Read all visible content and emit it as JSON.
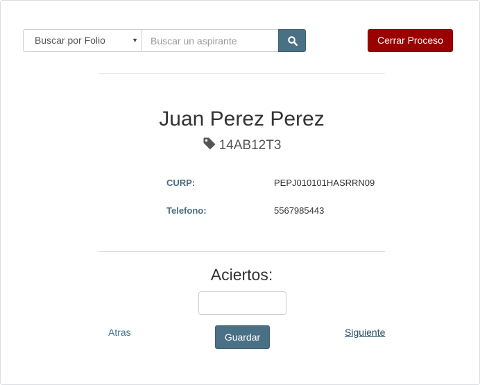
{
  "search": {
    "filter_selected": "Buscar por Folio",
    "placeholder": "Buscar un aspirante",
    "value": "",
    "button_icon": "search-icon"
  },
  "header": {
    "close_process_label": "Cerrar Proceso"
  },
  "candidate": {
    "name": "Juan Perez Perez",
    "folio_icon": "tag-icon",
    "folio": "14AB12T3",
    "fields": {
      "curp_label": "CURP:",
      "curp_value": "PEPJ010101HASRRN09",
      "phone_label": "Telefono:",
      "phone_value": "5567985443"
    }
  },
  "score": {
    "title": "Aciertos:",
    "value": ""
  },
  "navigation": {
    "back_label": "Atras",
    "save_label": "Guardar",
    "next_label": "Siguiente"
  },
  "colors": {
    "primary": "#4a7086",
    "danger": "#9b0000",
    "label": "#4a6b80"
  }
}
